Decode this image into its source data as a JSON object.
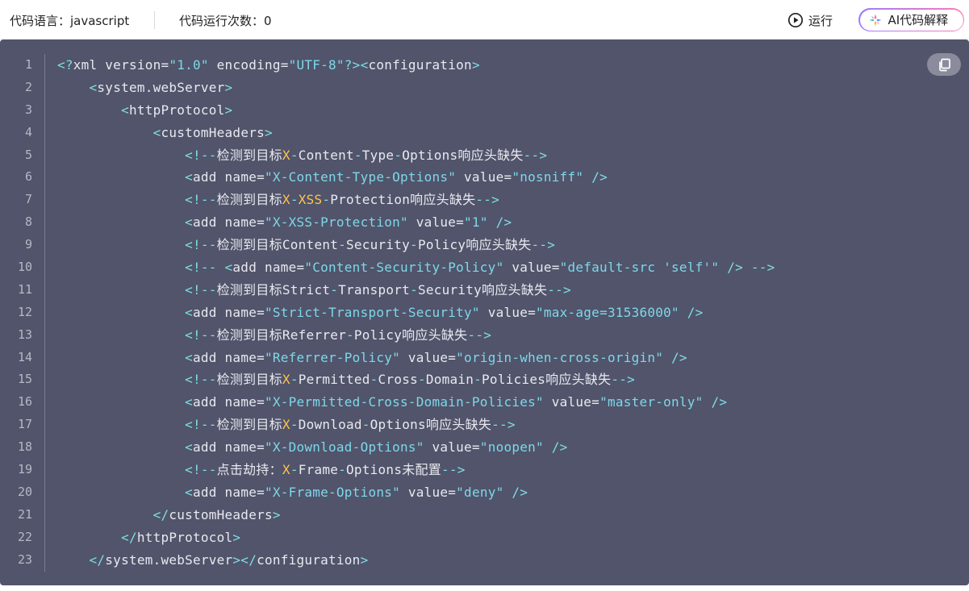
{
  "toolbar": {
    "language_label": "代码语言：javascript",
    "run_count_label": "代码运行次数：0",
    "run_label": "运行",
    "ai_label": "AI代码解释"
  },
  "icons": {
    "run": "play-circle-icon",
    "ai": "ai-sparkle-icon",
    "copy": "copy-icon"
  },
  "colors": {
    "code_bg": "#51546a",
    "string": "#7ed7ea",
    "punctuation": "#7fdde4",
    "highlight": "#ffc44d",
    "text": "#e8e9f0"
  },
  "code": {
    "line_numbers": [
      "1",
      "2",
      "3",
      "4",
      "5",
      "6",
      "7",
      "8",
      "9",
      "10",
      "11",
      "12",
      "13",
      "14",
      "15",
      "16",
      "17",
      "18",
      "19",
      "20",
      "21",
      "22",
      "23"
    ],
    "lines": [
      [
        [
          "p",
          "<?"
        ],
        [
          "t",
          "xml version="
        ],
        [
          "s",
          "\"1.0\""
        ],
        [
          "t",
          " encoding="
        ],
        [
          "s",
          "\"UTF-8\""
        ],
        [
          "p",
          "?><"
        ],
        [
          "t",
          "configuration"
        ],
        [
          "p",
          ">"
        ]
      ],
      [
        [
          "t",
          "    "
        ],
        [
          "p",
          "<"
        ],
        [
          "t",
          "system.webServer"
        ],
        [
          "p",
          ">"
        ]
      ],
      [
        [
          "t",
          "        "
        ],
        [
          "p",
          "<"
        ],
        [
          "t",
          "httpProtocol"
        ],
        [
          "p",
          ">"
        ]
      ],
      [
        [
          "t",
          "            "
        ],
        [
          "p",
          "<"
        ],
        [
          "t",
          "customHeaders"
        ],
        [
          "p",
          ">"
        ]
      ],
      [
        [
          "t",
          "                "
        ],
        [
          "p",
          "<!--"
        ],
        [
          "t",
          "检测到目标"
        ],
        [
          "h",
          "X"
        ],
        [
          "p",
          "-"
        ],
        [
          "t",
          "Content"
        ],
        [
          "p",
          "-"
        ],
        [
          "t",
          "Type"
        ],
        [
          "p",
          "-"
        ],
        [
          "t",
          "Options响应头缺失"
        ],
        [
          "p",
          "-->"
        ]
      ],
      [
        [
          "t",
          "                "
        ],
        [
          "p",
          "<"
        ],
        [
          "t",
          "add name="
        ],
        [
          "s",
          "\"X-Content-Type-Options\""
        ],
        [
          "t",
          " value="
        ],
        [
          "s",
          "\"nosniff\""
        ],
        [
          "t",
          " "
        ],
        [
          "p",
          "/>"
        ]
      ],
      [
        [
          "t",
          "                "
        ],
        [
          "p",
          "<!--"
        ],
        [
          "t",
          "检测到目标"
        ],
        [
          "h",
          "X"
        ],
        [
          "p",
          "-"
        ],
        [
          "h",
          "XSS"
        ],
        [
          "p",
          "-"
        ],
        [
          "t",
          "Protection响应头缺失"
        ],
        [
          "p",
          "-->"
        ]
      ],
      [
        [
          "t",
          "                "
        ],
        [
          "p",
          "<"
        ],
        [
          "t",
          "add name="
        ],
        [
          "s",
          "\"X-XSS-Protection\""
        ],
        [
          "t",
          " value="
        ],
        [
          "s",
          "\"1\""
        ],
        [
          "t",
          " "
        ],
        [
          "p",
          "/>"
        ]
      ],
      [
        [
          "t",
          "                "
        ],
        [
          "p",
          "<!--"
        ],
        [
          "t",
          "检测到目标Content"
        ],
        [
          "p",
          "-"
        ],
        [
          "t",
          "Security"
        ],
        [
          "p",
          "-"
        ],
        [
          "t",
          "Policy响应头缺失"
        ],
        [
          "p",
          "-->"
        ]
      ],
      [
        [
          "t",
          "                "
        ],
        [
          "p",
          "<!-- <"
        ],
        [
          "t",
          "add name="
        ],
        [
          "s",
          "\"Content-Security-Policy\""
        ],
        [
          "t",
          " value="
        ],
        [
          "s",
          "\"default-src 'self'\""
        ],
        [
          "t",
          " "
        ],
        [
          "p",
          "/> -->"
        ]
      ],
      [
        [
          "t",
          "                "
        ],
        [
          "p",
          "<!--"
        ],
        [
          "t",
          "检测到目标Strict"
        ],
        [
          "p",
          "-"
        ],
        [
          "t",
          "Transport"
        ],
        [
          "p",
          "-"
        ],
        [
          "t",
          "Security响应头缺失"
        ],
        [
          "p",
          "-->"
        ]
      ],
      [
        [
          "t",
          "                "
        ],
        [
          "p",
          "<"
        ],
        [
          "t",
          "add name="
        ],
        [
          "s",
          "\"Strict-Transport-Security\""
        ],
        [
          "t",
          " value="
        ],
        [
          "s",
          "\"max-age=31536000\""
        ],
        [
          "t",
          " "
        ],
        [
          "p",
          "/>"
        ]
      ],
      [
        [
          "t",
          "                "
        ],
        [
          "p",
          "<!--"
        ],
        [
          "t",
          "检测到目标Referrer"
        ],
        [
          "p",
          "-"
        ],
        [
          "t",
          "Policy响应头缺失"
        ],
        [
          "p",
          "-->"
        ]
      ],
      [
        [
          "t",
          "                "
        ],
        [
          "p",
          "<"
        ],
        [
          "t",
          "add name="
        ],
        [
          "s",
          "\"Referrer-Policy\""
        ],
        [
          "t",
          " value="
        ],
        [
          "s",
          "\"origin-when-cross-origin\""
        ],
        [
          "t",
          " "
        ],
        [
          "p",
          "/>"
        ]
      ],
      [
        [
          "t",
          "                "
        ],
        [
          "p",
          "<!--"
        ],
        [
          "t",
          "检测到目标"
        ],
        [
          "h",
          "X"
        ],
        [
          "p",
          "-"
        ],
        [
          "t",
          "Permitted"
        ],
        [
          "p",
          "-"
        ],
        [
          "t",
          "Cross"
        ],
        [
          "p",
          "-"
        ],
        [
          "t",
          "Domain"
        ],
        [
          "p",
          "-"
        ],
        [
          "t",
          "Policies响应头缺失"
        ],
        [
          "p",
          "-->"
        ]
      ],
      [
        [
          "t",
          "                "
        ],
        [
          "p",
          "<"
        ],
        [
          "t",
          "add name="
        ],
        [
          "s",
          "\"X-Permitted-Cross-Domain-Policies\""
        ],
        [
          "t",
          " value="
        ],
        [
          "s",
          "\"master-only\""
        ],
        [
          "t",
          " "
        ],
        [
          "p",
          "/>"
        ]
      ],
      [
        [
          "t",
          "                "
        ],
        [
          "p",
          "<!--"
        ],
        [
          "t",
          "检测到目标"
        ],
        [
          "h",
          "X"
        ],
        [
          "p",
          "-"
        ],
        [
          "t",
          "Download"
        ],
        [
          "p",
          "-"
        ],
        [
          "t",
          "Options响应头缺失"
        ],
        [
          "p",
          "-->"
        ]
      ],
      [
        [
          "t",
          "                "
        ],
        [
          "p",
          "<"
        ],
        [
          "t",
          "add name="
        ],
        [
          "s",
          "\"X-Download-Options\""
        ],
        [
          "t",
          " value="
        ],
        [
          "s",
          "\"noopen\""
        ],
        [
          "t",
          " "
        ],
        [
          "p",
          "/>"
        ]
      ],
      [
        [
          "t",
          "                "
        ],
        [
          "p",
          "<!--"
        ],
        [
          "t",
          "点击劫持："
        ],
        [
          "h",
          "X"
        ],
        [
          "p",
          "-"
        ],
        [
          "t",
          "Frame"
        ],
        [
          "p",
          "-"
        ],
        [
          "t",
          "Options未配置"
        ],
        [
          "p",
          "-->"
        ]
      ],
      [
        [
          "t",
          "                "
        ],
        [
          "p",
          "<"
        ],
        [
          "t",
          "add name="
        ],
        [
          "s",
          "\"X-Frame-Options\""
        ],
        [
          "t",
          " value="
        ],
        [
          "s",
          "\"deny\""
        ],
        [
          "t",
          " "
        ],
        [
          "p",
          "/>"
        ]
      ],
      [
        [
          "t",
          "            "
        ],
        [
          "p",
          "</"
        ],
        [
          "t",
          "customHeaders"
        ],
        [
          "p",
          ">"
        ]
      ],
      [
        [
          "t",
          "        "
        ],
        [
          "p",
          "</"
        ],
        [
          "t",
          "httpProtocol"
        ],
        [
          "p",
          ">"
        ]
      ],
      [
        [
          "t",
          "    "
        ],
        [
          "p",
          "</"
        ],
        [
          "t",
          "system.webServer"
        ],
        [
          "p",
          "></"
        ],
        [
          "t",
          "configuration"
        ],
        [
          "p",
          ">"
        ]
      ]
    ]
  }
}
